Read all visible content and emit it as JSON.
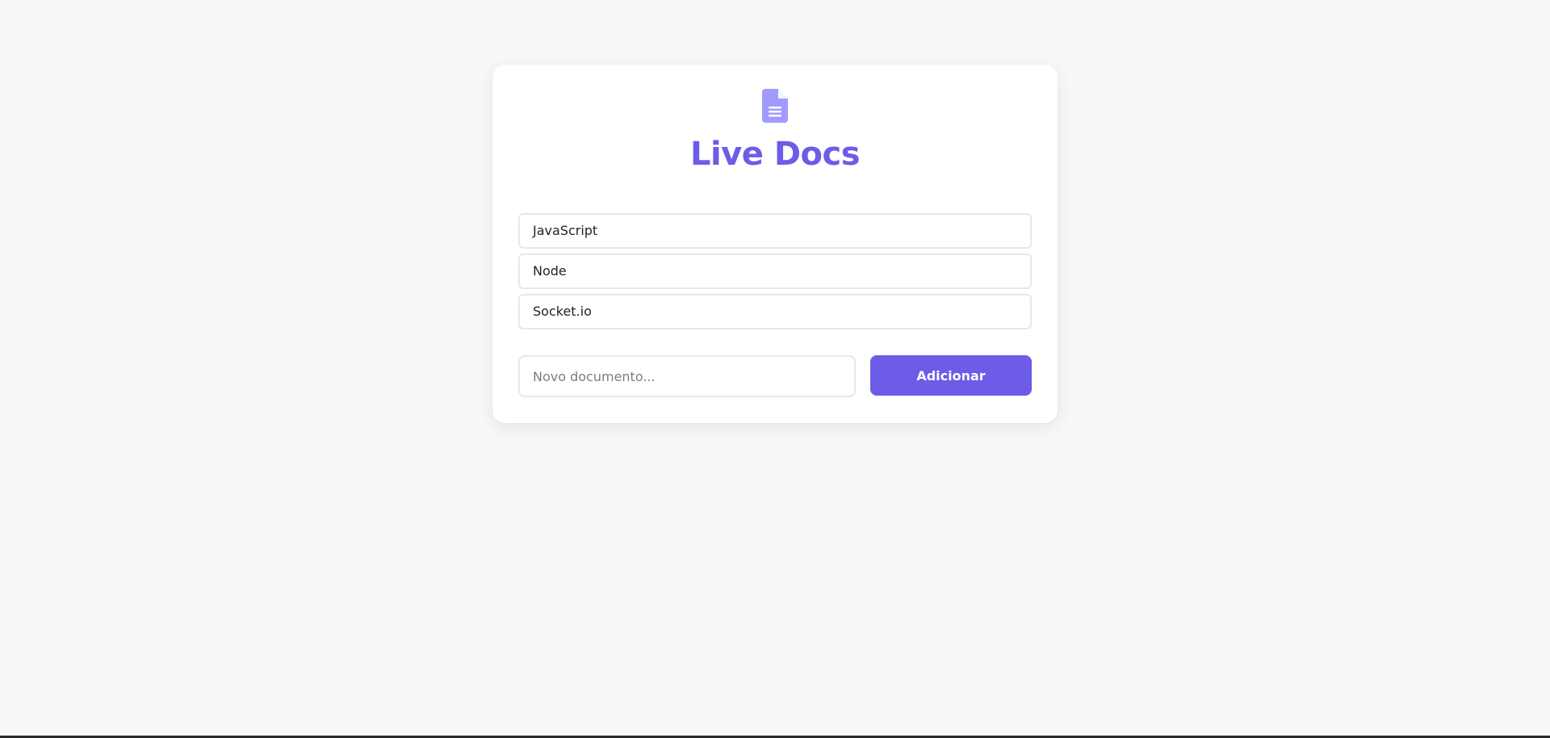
{
  "app": {
    "title": "Live Docs",
    "icon": "document-icon",
    "accent_color": "#6c5ce7",
    "icon_color": "#a29bfe"
  },
  "documents": [
    {
      "label": "JavaScript"
    },
    {
      "label": "Node"
    },
    {
      "label": "Socket.io"
    }
  ],
  "new_document": {
    "value": "",
    "placeholder": "Novo documento..."
  },
  "add_button": {
    "label": "Adicionar"
  }
}
